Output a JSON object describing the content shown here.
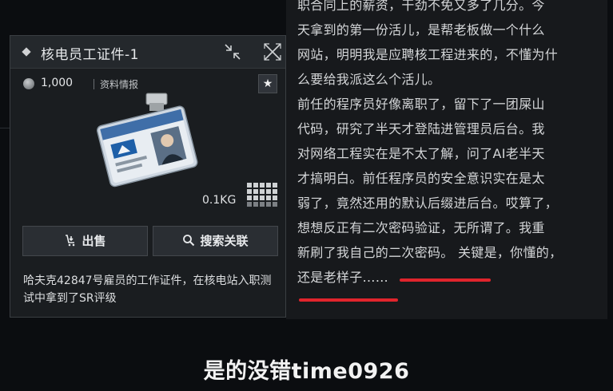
{
  "item": {
    "title": "核电员工证件-1",
    "price": "1,000",
    "category": "资料情报",
    "weight": "0.1KG",
    "sell_label": "出售",
    "search_label": "搜索关联",
    "description": "哈夫克42847号雇员的工作证件，在核电站入职测试中拿到了SR评级"
  },
  "story": {
    "lines": [
      "职合同上的薪资，干劲不免又多了几分。今",
      "天拿到的第一份活儿，是帮老板做一个什么",
      "网站，明明我是应聘核工程进来的，不懂为什",
      "么要给我派这么个活儿。",
      "前任的程序员好像离职了，留下了一团屎山",
      "代码，研究了半天才登陆进管理员后台。我",
      "对网络工程实在是不太了解，问了AI老半天",
      "才搞明白。前任程序员的安全意识实在是太",
      "弱了，竟然还用的默认后缀进后台。哎算了，",
      "想想反正有二次密码验证，无所谓了。我重",
      "新刷了我自己的二次密码。 关键是，你懂的，",
      "还是老样子……"
    ]
  },
  "subtitle": "是的没错time0926",
  "colors": {
    "accent_red": "#e0242c",
    "panel_bg": "#1a1d20",
    "text_bg": "#17191c"
  },
  "icons": [
    "diamond-icon",
    "collapse-icon",
    "close-icon",
    "coin-icon",
    "star-icon",
    "grid-icon",
    "sell-icon",
    "search-icon"
  ]
}
